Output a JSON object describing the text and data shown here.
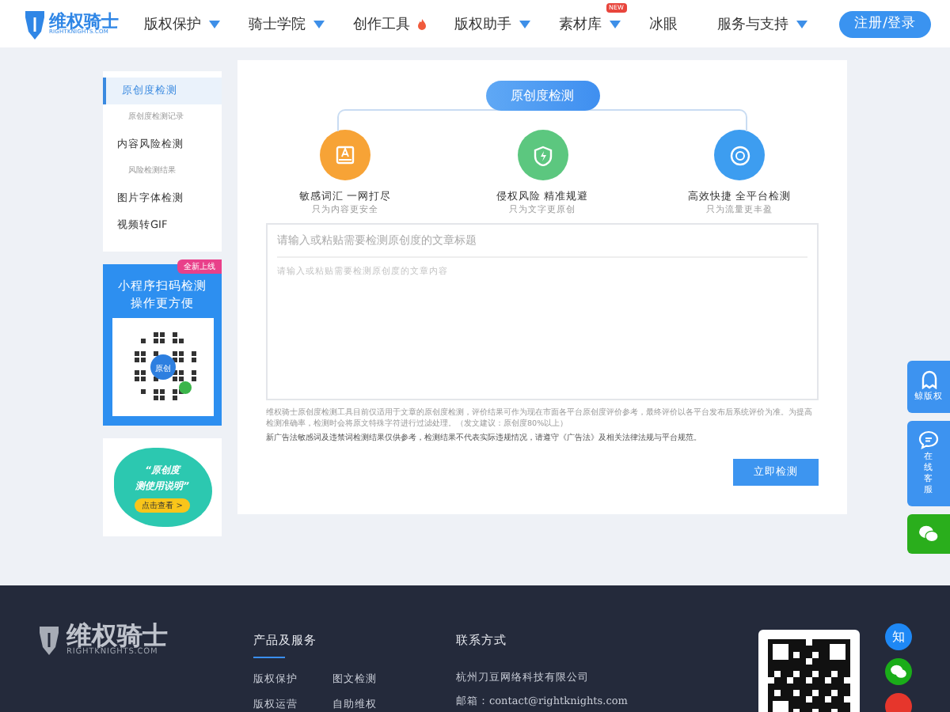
{
  "header": {
    "logo": {
      "name": "维权骑士",
      "domain": "RIGHTKNIGHTS.COM"
    },
    "nav": [
      {
        "label": "版权保护",
        "dropdown": true,
        "hot": false
      },
      {
        "label": "骑士学院",
        "dropdown": true,
        "hot": false
      },
      {
        "label": "创作工具",
        "dropdown": false,
        "hot": true
      },
      {
        "label": "版权助手",
        "dropdown": true,
        "hot": false
      },
      {
        "label": "素材库",
        "dropdown": true,
        "hot": false,
        "badge": "NEW"
      },
      {
        "label": "冰眼",
        "dropdown": false,
        "hot": false
      }
    ],
    "support": {
      "label": "服务与支持",
      "dropdown": true
    },
    "login_button": "注册/登录"
  },
  "sidebar": {
    "items": [
      {
        "label": "原创度检测",
        "selected": true,
        "children": [
          {
            "label": "原创度检测记录",
            "selected": false
          }
        ]
      },
      {
        "label": "内容风险检测",
        "selected": false,
        "children": [
          {
            "label": "风险检测结果",
            "selected": false
          }
        ]
      },
      {
        "label": "图片字体检测",
        "selected": false
      },
      {
        "label": "视频转GIF",
        "selected": false
      }
    ],
    "miniprogram": {
      "tag": "全新上线",
      "title": "小程序扫码检测",
      "subtitle": "操作更方便",
      "qr_label": "原创"
    },
    "promo": {
      "line_1": "“原创度",
      "line_2": "测使用说明”",
      "button": "点击查看 >"
    }
  },
  "panel": {
    "title": "原创度检测",
    "features": [
      {
        "kind": "book",
        "title": "敏感词汇 一网打尽",
        "subtitle": "只为内容更安全",
        "color": "#f7a336"
      },
      {
        "kind": "shield",
        "title": "侵权风险 精准规避",
        "subtitle": "只为文字更原创",
        "color": "#5cc77f"
      },
      {
        "kind": "target",
        "title": "高效快捷 全平台检测",
        "subtitle": "只为流量更丰盈",
        "color": "#3d9df0"
      }
    ],
    "title_field": {
      "placeholder": "请输入或粘贴需要检测原创度的文章标题"
    },
    "content_field": {
      "placeholder": "请输入或粘贴需要检测原创度的文章内容"
    },
    "notes": [
      "维权骑士原创度检测工具目前仅适用于文章的原创度检测，评价结果可作为现在市面各平台原创度评价参考，最终评价以各平台发布后系统评价为准。为提高检测准确率，检测时会将原文特殊字符进行过滤处理。（发文建议：原创度80%以上）",
      "新广告法敏感词及违禁词检测结果仅供参考，检测结果不代表实际违规情况，请遵守《广告法》及相关法律法规与平台规范。"
    ],
    "submit_button": "立即检测"
  },
  "float_bar": [
    {
      "kind": "ghost",
      "label": "鲸版权"
    },
    {
      "kind": "chat",
      "label": "在线客服"
    },
    {
      "kind": "wechat"
    }
  ],
  "footer": {
    "logo": {
      "name": "维权骑士",
      "domain": "RIGHTKNIGHTS.COM"
    },
    "products": {
      "heading": "产品及服务",
      "links": [
        "版权保护",
        "图文检测",
        "版权运营",
        "自助维权"
      ]
    },
    "contact": {
      "heading": "联系方式",
      "lines": [
        "杭州刀豆网络科技有限公司",
        "邮箱：contact@rightknights.com"
      ]
    },
    "social": [
      {
        "kind": "zhihu",
        "label": "知",
        "color": "#1e88f5"
      },
      {
        "kind": "wechat",
        "color": "#1aad19"
      },
      {
        "kind": "weibo",
        "color": "#e6362c"
      }
    ]
  }
}
